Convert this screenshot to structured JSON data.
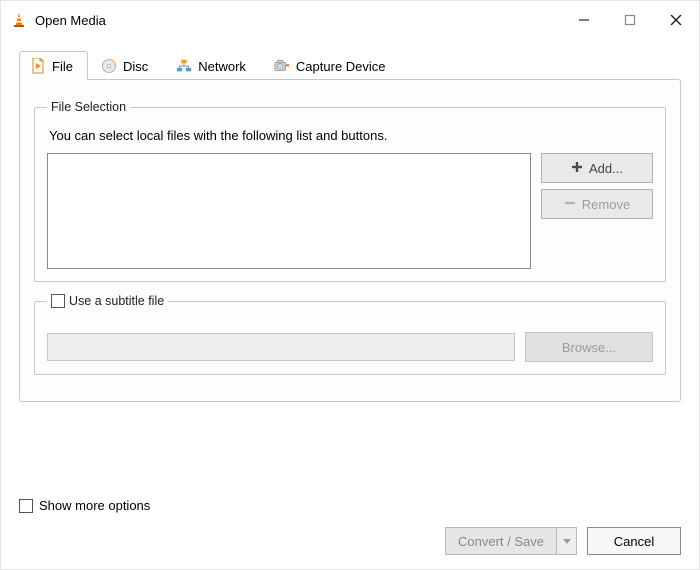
{
  "window": {
    "title": "Open Media"
  },
  "tabs": {
    "file": {
      "label": "File"
    },
    "disc": {
      "label": "Disc"
    },
    "network": {
      "label": "Network"
    },
    "capture": {
      "label": "Capture Device"
    }
  },
  "fileSelection": {
    "legend": "File Selection",
    "hint": "You can select local files with the following list and buttons.",
    "addLabel": "Add...",
    "removeLabel": "Remove"
  },
  "subtitle": {
    "legend": "Use a subtitle file",
    "browseLabel": "Browse..."
  },
  "moreOptions": {
    "label": "Show more options"
  },
  "actions": {
    "convertSave": "Convert / Save",
    "cancel": "Cancel"
  }
}
